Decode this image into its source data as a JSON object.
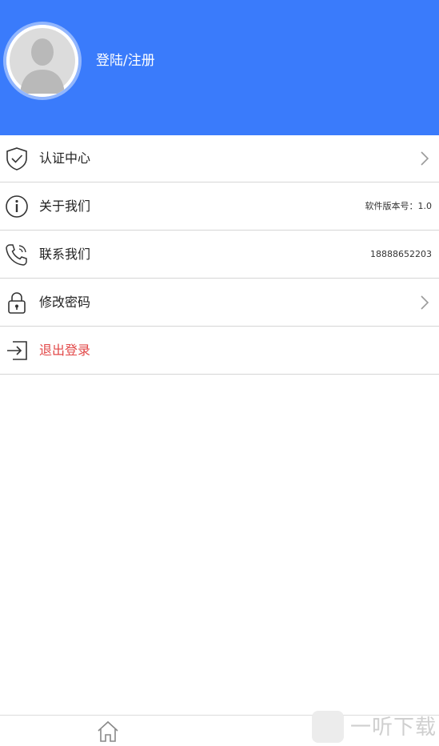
{
  "header": {
    "login_label": "登陆/注册"
  },
  "menu": {
    "items": [
      {
        "label": "认证中心",
        "value": "",
        "icon": "shield-check-icon"
      },
      {
        "label": "关于我们",
        "value": "软件版本号：1.0",
        "icon": "info-icon"
      },
      {
        "label": "联系我们",
        "value": "18888652203",
        "icon": "phone-icon"
      },
      {
        "label": "修改密码",
        "value": "",
        "icon": "lock-icon"
      },
      {
        "label": "退出登录",
        "value": "",
        "icon": "logout-icon"
      }
    ]
  },
  "tabbar": {
    "home_icon": "home-icon",
    "mine_icon": "user-icon"
  },
  "watermark": {
    "text": "一听下载"
  },
  "colors": {
    "header_bg": "#3a7bfb",
    "danger": "#e24848",
    "divider": "#d6d6d6"
  }
}
